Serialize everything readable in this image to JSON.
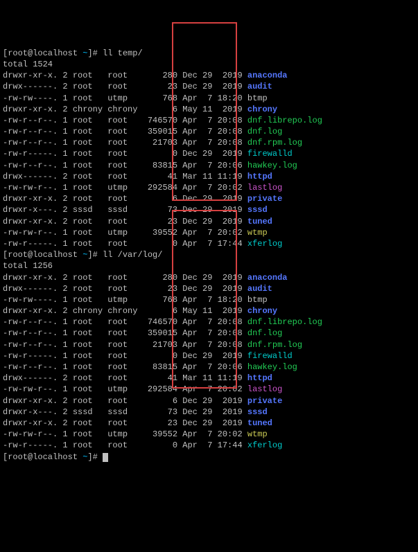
{
  "prompts": {
    "p1_user": "[root@localhost ",
    "p1_tilde": "~",
    "p1_close": "]# ",
    "p1_cmd": "ll temp/",
    "p2_user": "[root@localhost ",
    "p2_tilde": "~",
    "p2_close": "]# ",
    "p2_cmd": "ll /var/log/",
    "p3_user": "[root@localhost ",
    "p3_tilde": "~",
    "p3_close": "]# "
  },
  "totals": {
    "t1": "total 1524",
    "t2": "total 1256"
  },
  "rows": [
    {
      "perm": "drwxr-xr-x. 2 root   root       280 ",
      "date": "Dec 29  2019 ",
      "name": "anaconda",
      "cls": "f-blue"
    },
    {
      "perm": "drwx------. 2 root   root        23 ",
      "date": "Dec 29  2019 ",
      "name": "audit",
      "cls": "f-blue"
    },
    {
      "perm": "-rw-rw----. 1 root   utmp       768 ",
      "date": "Apr  7 18:20 ",
      "name": "btmp",
      "cls": "f-w"
    },
    {
      "perm": "drwxr-xr-x. 2 chrony chrony       6 ",
      "date": "May 11  2019 ",
      "name": "chrony",
      "cls": "f-blue"
    },
    {
      "perm": "-rw-r--r--. 1 root   root    746570 ",
      "date": "Apr  7 20:08 ",
      "name": "dnf.librepo.log",
      "cls": "f-green"
    },
    {
      "perm": "-rw-r--r--. 1 root   root    359015 ",
      "date": "Apr  7 20:08 ",
      "name": "dnf.log",
      "cls": "f-green"
    },
    {
      "perm": "-rw-r--r--. 1 root   root     21703 ",
      "date": "Apr  7 20:08 ",
      "name": "dnf.rpm.log",
      "cls": "f-green"
    },
    {
      "perm": "-rw-r-----. 1 root   root         0 ",
      "date": "Dec 29  2019 ",
      "name": "firewalld",
      "cls": "f-cyan"
    },
    {
      "perm": "-rw-r--r--. 1 root   root     83815 ",
      "date": "Apr  7 20:06 ",
      "name": "hawkey.log",
      "cls": "f-green"
    },
    {
      "perm": "drwx------. 2 root   root        41 ",
      "date": "Mar 11 11:19 ",
      "name": "httpd",
      "cls": "f-blue"
    },
    {
      "perm": "-rw-rw-r--. 1 root   utmp    292584 ",
      "date": "Apr  7 20:02 ",
      "name": "lastlog",
      "cls": "f-mag"
    },
    {
      "perm": "drwxr-xr-x. 2 root   root         6 ",
      "date": "Dec 29  2019 ",
      "name": "private",
      "cls": "f-blue"
    },
    {
      "perm": "drwxr-x---. 2 sssd   sssd        73 ",
      "date": "Dec 29  2019 ",
      "name": "sssd",
      "cls": "f-blue"
    },
    {
      "perm": "drwxr-xr-x. 2 root   root        23 ",
      "date": "Dec 29  2019 ",
      "name": "tuned",
      "cls": "f-blue"
    },
    {
      "perm": "-rw-rw-r--. 1 root   utmp     39552 ",
      "date": "Apr  7 20:02 ",
      "name": "wtmp",
      "cls": "f-yel"
    },
    {
      "perm": "-rw-r-----. 1 root   root         0 ",
      "date": "Apr  7 17:44 ",
      "name": "xferlog",
      "cls": "f-cyan"
    }
  ]
}
